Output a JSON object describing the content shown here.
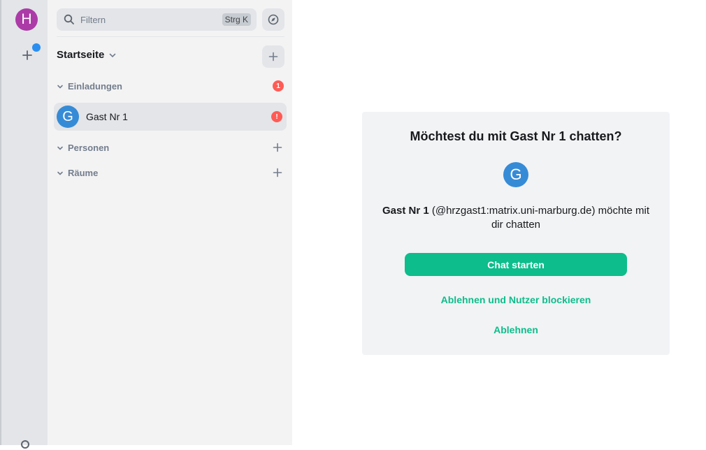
{
  "spacebar": {
    "user_initial": "H",
    "user_avatar_color": "#ac3ba8",
    "notification_color": "#2a8ef0"
  },
  "roomlist": {
    "search": {
      "placeholder": "Filtern",
      "shortcut": "Strg K"
    },
    "home_title": "Startseite",
    "sections": {
      "invites": {
        "label": "Einladungen",
        "badge": "1"
      },
      "people": {
        "label": "Personen"
      },
      "rooms": {
        "label": "Räume"
      }
    },
    "invite_room": {
      "initial": "G",
      "name": "Gast Nr 1",
      "badge": "!",
      "avatar_color": "#368bd6"
    }
  },
  "invite": {
    "title": "Möchtest du mit Gast Nr 1 chatten?",
    "avatar_initial": "G",
    "inviter_name": "Gast Nr 1",
    "inviter_detail": " (@hrzgast1:matrix.uni-marburg.de) möchte mit dir chatten",
    "accept_label": "Chat starten",
    "reject_block_label": "Ablehnen und Nutzer blockieren",
    "reject_label": "Ablehnen"
  },
  "colors": {
    "accent": "#0dbd8b",
    "alert": "#ff5b55",
    "panel_bg": "#f1f3f5"
  }
}
